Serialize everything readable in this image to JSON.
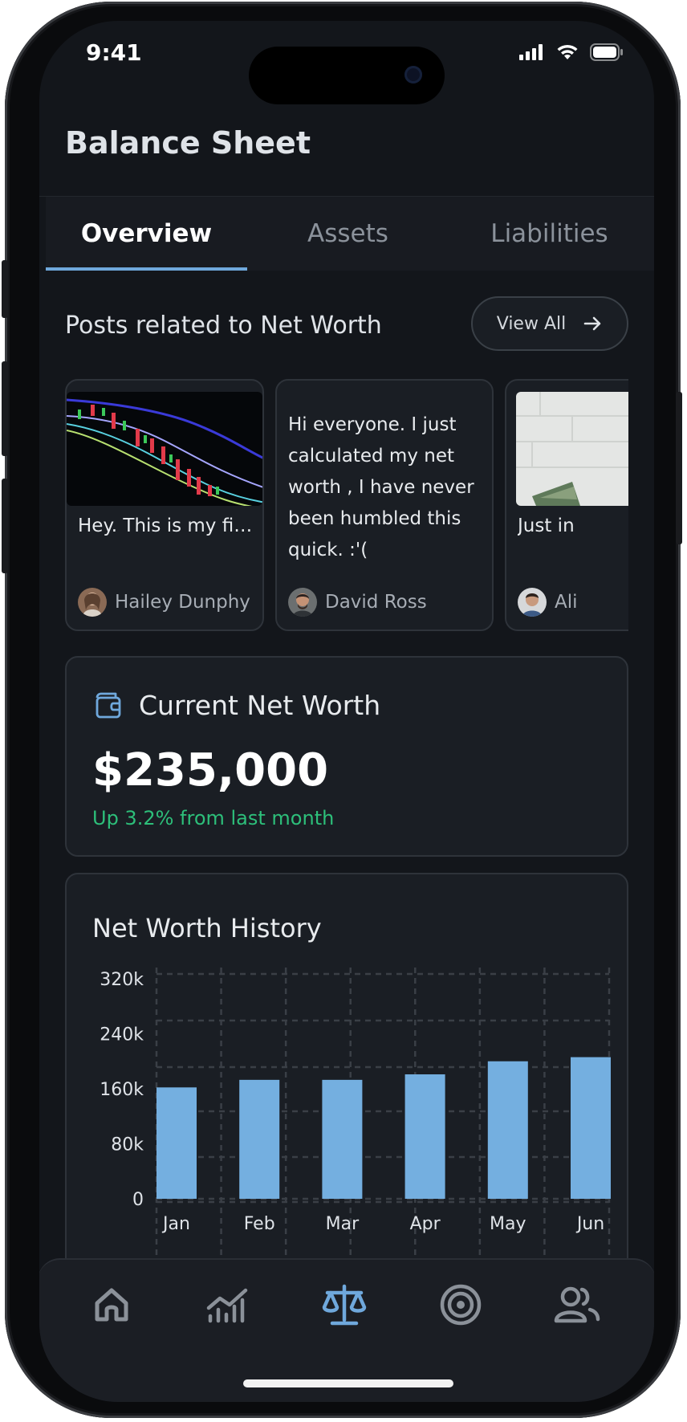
{
  "status_bar": {
    "time": "9:41"
  },
  "header": {
    "title": "Balance Sheet"
  },
  "tabs": [
    {
      "label": "Overview",
      "active": true
    },
    {
      "label": "Assets",
      "active": false
    },
    {
      "label": "Liabilities",
      "active": false
    }
  ],
  "posts_section": {
    "heading": "Posts related to Net Worth",
    "view_all_label": "View All",
    "posts": [
      {
        "text": "Hey. This is my first p...",
        "author": "Hailey Dunphy",
        "image": "stock-chart-image"
      },
      {
        "text": "Hi everyone. I just calculated my net worth , I have never been humbled this quick. :'(",
        "author": "David Ross"
      },
      {
        "text": "Just in",
        "author": "Ali",
        "image": "money-photo"
      }
    ]
  },
  "net_worth": {
    "label": "Current Net Worth",
    "icon": "wallet-icon",
    "value": "$235,000",
    "change": "Up 3.2% from last month",
    "change_color": "#2dbf7a"
  },
  "history": {
    "title": "Net Worth History"
  },
  "chart_data": {
    "type": "bar",
    "title": "Net Worth History",
    "categories": [
      "Jan",
      "Feb",
      "Mar",
      "Apr",
      "May",
      "Jun"
    ],
    "values": [
      162000,
      173000,
      173000,
      181000,
      200000,
      206000
    ],
    "y_ticks": [
      "0",
      "80k",
      "160k",
      "240k",
      "320k"
    ],
    "ylim": [
      0,
      320000
    ],
    "grid": true,
    "bar_color": "#74afe0"
  },
  "bottom_nav": [
    {
      "icon": "home-icon",
      "active": false
    },
    {
      "icon": "bar-chart-icon",
      "active": false
    },
    {
      "icon": "balance-scale-icon",
      "active": true
    },
    {
      "icon": "target-icon",
      "active": false
    },
    {
      "icon": "users-icon",
      "active": false
    }
  ],
  "colors": {
    "accent": "#6fa8dc",
    "background": "#13161b",
    "card": "#1a1e24"
  }
}
